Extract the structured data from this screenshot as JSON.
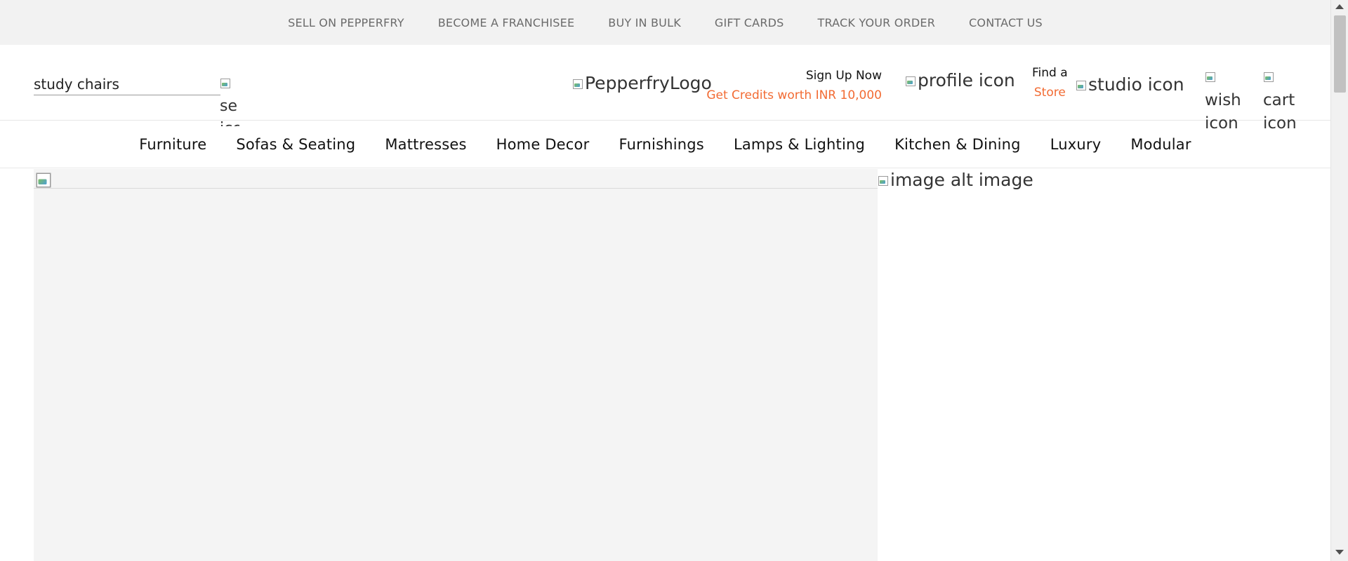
{
  "topbar": {
    "links": [
      "SELL ON PEPPERFRY",
      "BECOME A FRANCHISEE",
      "BUY IN BULK",
      "GIFT CARDS",
      "TRACK YOUR ORDER",
      "CONTACT US"
    ]
  },
  "header": {
    "search": {
      "value": "study chairs",
      "icon_alt": "se icc"
    },
    "logo_alt": "PepperfryLogo",
    "signup": {
      "title": "Sign Up Now",
      "credits": "Get Credits worth INR 10,000"
    },
    "profile_icon_alt": "profile icon",
    "find_store": {
      "line1": "Find a",
      "line2": "Store"
    },
    "studio_icon_alt": "studio icon",
    "wish_icon_alt": "wish icon",
    "cart_icon_alt": "cart icon"
  },
  "categories": [
    "Furniture",
    "Sofas & Seating",
    "Mattresses",
    "Home Decor",
    "Furnishings",
    "Lamps & Lighting",
    "Kitchen & Dining",
    "Luxury",
    "Modular"
  ],
  "main": {
    "side_image_alt": "image alt image"
  },
  "colors": {
    "accent": "#f26b33",
    "topbar_bg": "#f2f2f2",
    "banner_bg": "#f4f4f4"
  }
}
